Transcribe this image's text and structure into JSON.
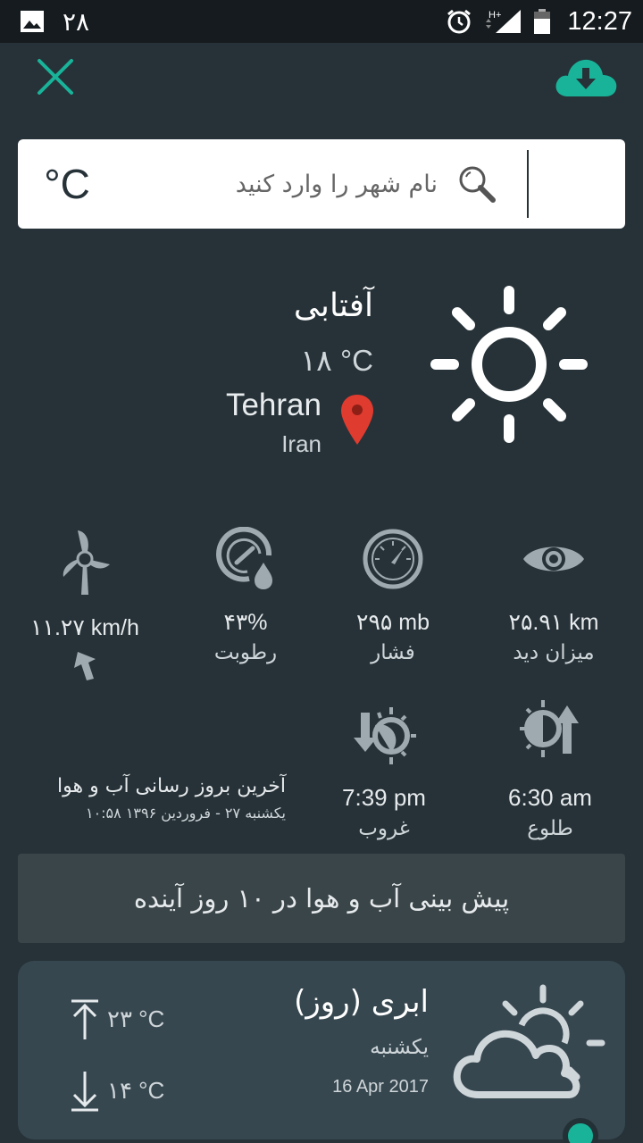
{
  "status_bar": {
    "notification_count": "۲۸",
    "time": "12:27",
    "network": "H+"
  },
  "toolbar": {
    "close_icon": "close-icon",
    "download_icon": "cloud-download-icon",
    "accent_color": "#19b39a"
  },
  "search": {
    "placeholder": "نام شهر را وارد کنید",
    "unit_label": "°C"
  },
  "current": {
    "condition": "آفتابی",
    "temperature": "۱۸ °C",
    "city": "Tehran",
    "country": "Iran",
    "icon": "sun-icon"
  },
  "stats": {
    "wind": {
      "value": "۱۱.۲۷ km/h",
      "icon": "wind-turbine-icon"
    },
    "humidity": {
      "value": "۴۳%",
      "label": "رطوبت",
      "icon": "humidity-gauge-icon"
    },
    "pressure": {
      "value": "۲۹۵ mb",
      "label": "فشار",
      "icon": "pressure-gauge-icon"
    },
    "visibility": {
      "value": "۲۵.۹۱ km",
      "label": "میزان دید",
      "icon": "eye-icon"
    },
    "sunset": {
      "value": "7:39 pm",
      "label": "غروب",
      "icon": "sunset-icon"
    },
    "sunrise": {
      "value": "6:30 am",
      "label": "طلوع",
      "icon": "sunrise-icon"
    }
  },
  "last_update": {
    "title": "آخرین بروز رسانی آب و هوا",
    "date": "یکشنبه ۲۷ - فروردین ۱۳۹۶  ۱۰:۵۸"
  },
  "forecast_button": {
    "label": "پیش بینی آب و هوا در ۱۰ روز آینده"
  },
  "day_card": {
    "condition": "ابری (روز)",
    "weekday": "یکشنبه",
    "date": "16 Apr 2017",
    "max_temp": "۲۳ °C",
    "min_temp": "۱۴ °C",
    "icon": "partly-cloudy-icon"
  }
}
